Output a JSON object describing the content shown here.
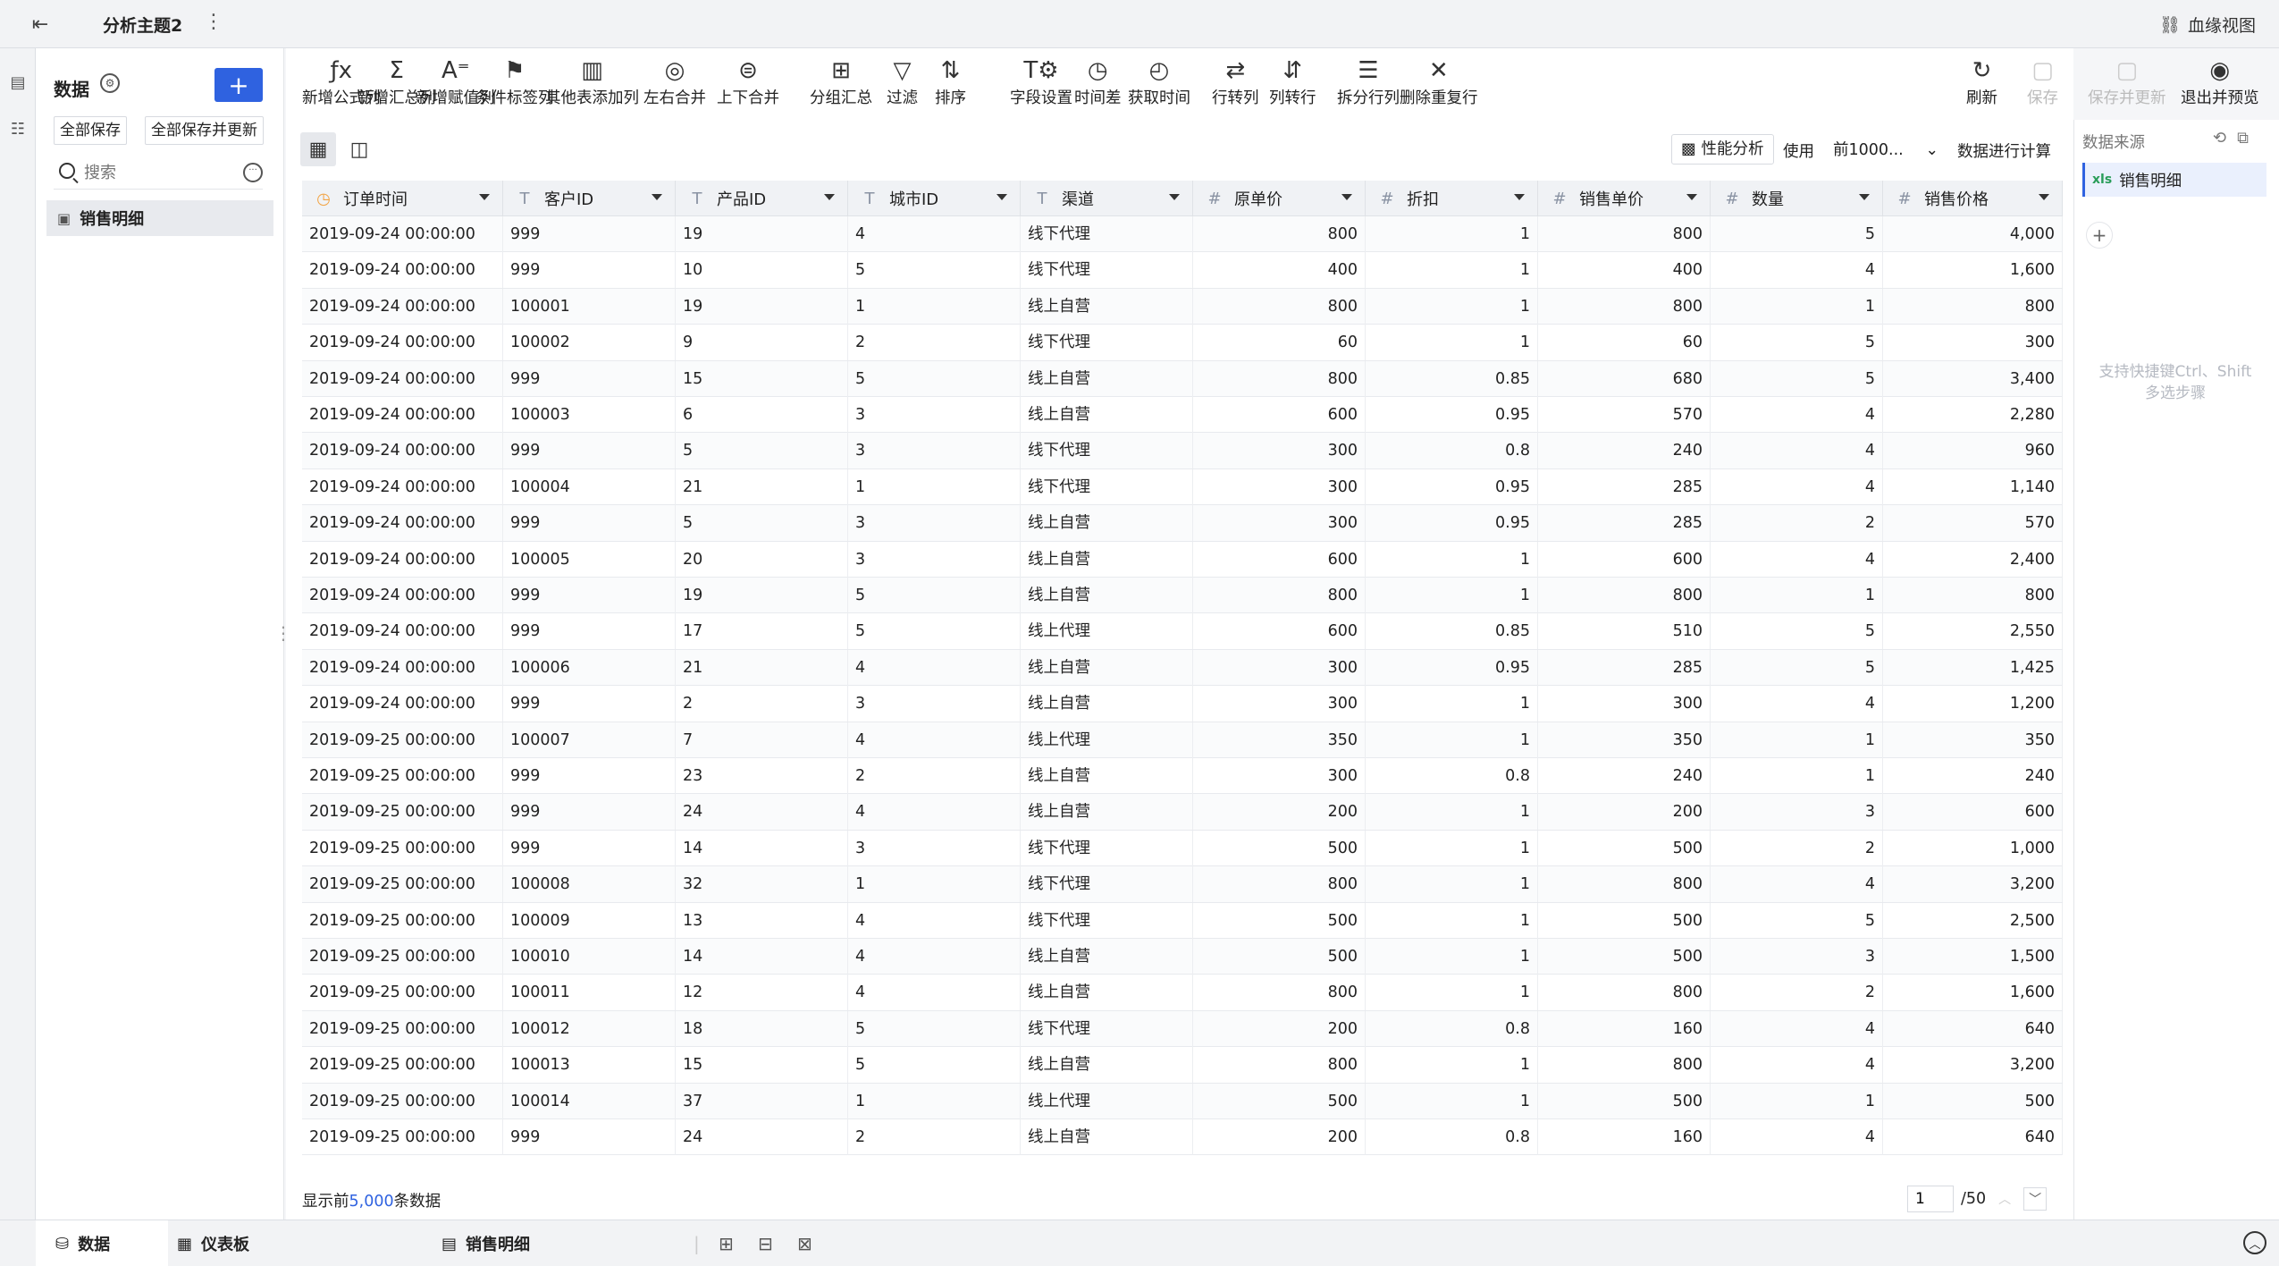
{
  "topbar": {
    "title": "分析主题2",
    "lineage": "血缘视图"
  },
  "leftpanel": {
    "title": "数据",
    "save_all": "全部保存",
    "save_all_update": "全部保存并更新",
    "search_placeholder": "搜索",
    "item": "销售明细"
  },
  "toolbar": {
    "items": [
      {
        "label": "新增公式列",
        "icon": "fx-icon"
      },
      {
        "label": "新增汇总列",
        "icon": "sigma-icon"
      },
      {
        "label": "新增赋值列",
        "icon": "assign-icon"
      },
      {
        "label": "条件标签列",
        "icon": "flag-icon"
      },
      {
        "label": "其他表添加列",
        "icon": "add-column-icon"
      },
      {
        "label": "左右合并",
        "icon": "merge-lr-icon"
      },
      {
        "label": "上下合并",
        "icon": "merge-ud-icon"
      },
      {
        "label": "分组汇总",
        "icon": "group-icon"
      },
      {
        "label": "过滤",
        "icon": "filter-icon"
      },
      {
        "label": "排序",
        "icon": "sort-icon"
      },
      {
        "label": "字段设置",
        "icon": "field-settings-icon"
      },
      {
        "label": "时间差",
        "icon": "time-diff-icon"
      },
      {
        "label": "获取时间",
        "icon": "get-time-icon"
      },
      {
        "label": "行转列",
        "icon": "row-to-col-icon"
      },
      {
        "label": "列转行",
        "icon": "col-to-row-icon"
      },
      {
        "label": "拆分行列",
        "icon": "split-icon"
      },
      {
        "label": "删除重复行",
        "icon": "dedupe-icon"
      }
    ],
    "refresh": "刷新",
    "save": "保存",
    "save_update": "保存并更新",
    "exit_preview": "退出并预览"
  },
  "main": {
    "perf_btn": "性能分析",
    "use_label": "使用",
    "use_value": "前1000...",
    "calc_btn": "数据进行计算",
    "footer_prefix": "显示前",
    "footer_count": "5,000",
    "footer_suffix": "条数据",
    "page_value": "1",
    "page_total": "/50"
  },
  "table": {
    "columns": [
      {
        "name": "订单时间",
        "type": "date"
      },
      {
        "name": "客户ID",
        "type": "text"
      },
      {
        "name": "产品ID",
        "type": "text"
      },
      {
        "name": "城市ID",
        "type": "text"
      },
      {
        "name": "渠道",
        "type": "text"
      },
      {
        "name": "原单价",
        "type": "number"
      },
      {
        "name": "折扣",
        "type": "number"
      },
      {
        "name": "销售单价",
        "type": "number"
      },
      {
        "name": "数量",
        "type": "number"
      },
      {
        "name": "销售价格",
        "type": "number"
      }
    ],
    "rows": [
      [
        "2019-09-24 00:00:00",
        "999",
        "19",
        "4",
        "线下代理",
        "800",
        "1",
        "800",
        "5",
        "4,000"
      ],
      [
        "2019-09-24 00:00:00",
        "999",
        "10",
        "5",
        "线下代理",
        "400",
        "1",
        "400",
        "4",
        "1,600"
      ],
      [
        "2019-09-24 00:00:00",
        "100001",
        "19",
        "1",
        "线上自营",
        "800",
        "1",
        "800",
        "1",
        "800"
      ],
      [
        "2019-09-24 00:00:00",
        "100002",
        "9",
        "2",
        "线下代理",
        "60",
        "1",
        "60",
        "5",
        "300"
      ],
      [
        "2019-09-24 00:00:00",
        "999",
        "15",
        "5",
        "线上自营",
        "800",
        "0.85",
        "680",
        "5",
        "3,400"
      ],
      [
        "2019-09-24 00:00:00",
        "100003",
        "6",
        "3",
        "线上自营",
        "600",
        "0.95",
        "570",
        "4",
        "2,280"
      ],
      [
        "2019-09-24 00:00:00",
        "999",
        "5",
        "3",
        "线下代理",
        "300",
        "0.8",
        "240",
        "4",
        "960"
      ],
      [
        "2019-09-24 00:00:00",
        "100004",
        "21",
        "1",
        "线下代理",
        "300",
        "0.95",
        "285",
        "4",
        "1,140"
      ],
      [
        "2019-09-24 00:00:00",
        "999",
        "5",
        "3",
        "线上自营",
        "300",
        "0.95",
        "285",
        "2",
        "570"
      ],
      [
        "2019-09-24 00:00:00",
        "100005",
        "20",
        "3",
        "线上自营",
        "600",
        "1",
        "600",
        "4",
        "2,400"
      ],
      [
        "2019-09-24 00:00:00",
        "999",
        "19",
        "5",
        "线上自营",
        "800",
        "1",
        "800",
        "1",
        "800"
      ],
      [
        "2019-09-24 00:00:00",
        "999",
        "17",
        "5",
        "线上代理",
        "600",
        "0.85",
        "510",
        "5",
        "2,550"
      ],
      [
        "2019-09-24 00:00:00",
        "100006",
        "21",
        "4",
        "线上自营",
        "300",
        "0.95",
        "285",
        "5",
        "1,425"
      ],
      [
        "2019-09-24 00:00:00",
        "999",
        "2",
        "3",
        "线上自营",
        "300",
        "1",
        "300",
        "4",
        "1,200"
      ],
      [
        "2019-09-25 00:00:00",
        "100007",
        "7",
        "4",
        "线上代理",
        "350",
        "1",
        "350",
        "1",
        "350"
      ],
      [
        "2019-09-25 00:00:00",
        "999",
        "23",
        "2",
        "线上自营",
        "300",
        "0.8",
        "240",
        "1",
        "240"
      ],
      [
        "2019-09-25 00:00:00",
        "999",
        "24",
        "4",
        "线上自营",
        "200",
        "1",
        "200",
        "3",
        "600"
      ],
      [
        "2019-09-25 00:00:00",
        "999",
        "14",
        "3",
        "线下代理",
        "500",
        "1",
        "500",
        "2",
        "1,000"
      ],
      [
        "2019-09-25 00:00:00",
        "100008",
        "32",
        "1",
        "线下代理",
        "800",
        "1",
        "800",
        "4",
        "3,200"
      ],
      [
        "2019-09-25 00:00:00",
        "100009",
        "13",
        "4",
        "线下代理",
        "500",
        "1",
        "500",
        "5",
        "2,500"
      ],
      [
        "2019-09-25 00:00:00",
        "100010",
        "14",
        "4",
        "线上自营",
        "500",
        "1",
        "500",
        "3",
        "1,500"
      ],
      [
        "2019-09-25 00:00:00",
        "100011",
        "12",
        "4",
        "线上自营",
        "800",
        "1",
        "800",
        "2",
        "1,600"
      ],
      [
        "2019-09-25 00:00:00",
        "100012",
        "18",
        "5",
        "线下代理",
        "200",
        "0.8",
        "160",
        "4",
        "640"
      ],
      [
        "2019-09-25 00:00:00",
        "100013",
        "15",
        "5",
        "线上自营",
        "800",
        "1",
        "800",
        "4",
        "3,200"
      ],
      [
        "2019-09-25 00:00:00",
        "100014",
        "37",
        "1",
        "线上代理",
        "500",
        "1",
        "500",
        "1",
        "500"
      ],
      [
        "2019-09-25 00:00:00",
        "999",
        "24",
        "2",
        "线上自营",
        "200",
        "0.8",
        "160",
        "4",
        "640"
      ]
    ]
  },
  "rightpane": {
    "title": "数据来源",
    "source_type": "xls",
    "source": "销售明细",
    "tip": "支持快捷键Ctrl、Shift多选步骤"
  },
  "bottombar": {
    "tab_data": "数据",
    "tab_dashboard": "仪表板",
    "tab_detail": "销售明细"
  }
}
